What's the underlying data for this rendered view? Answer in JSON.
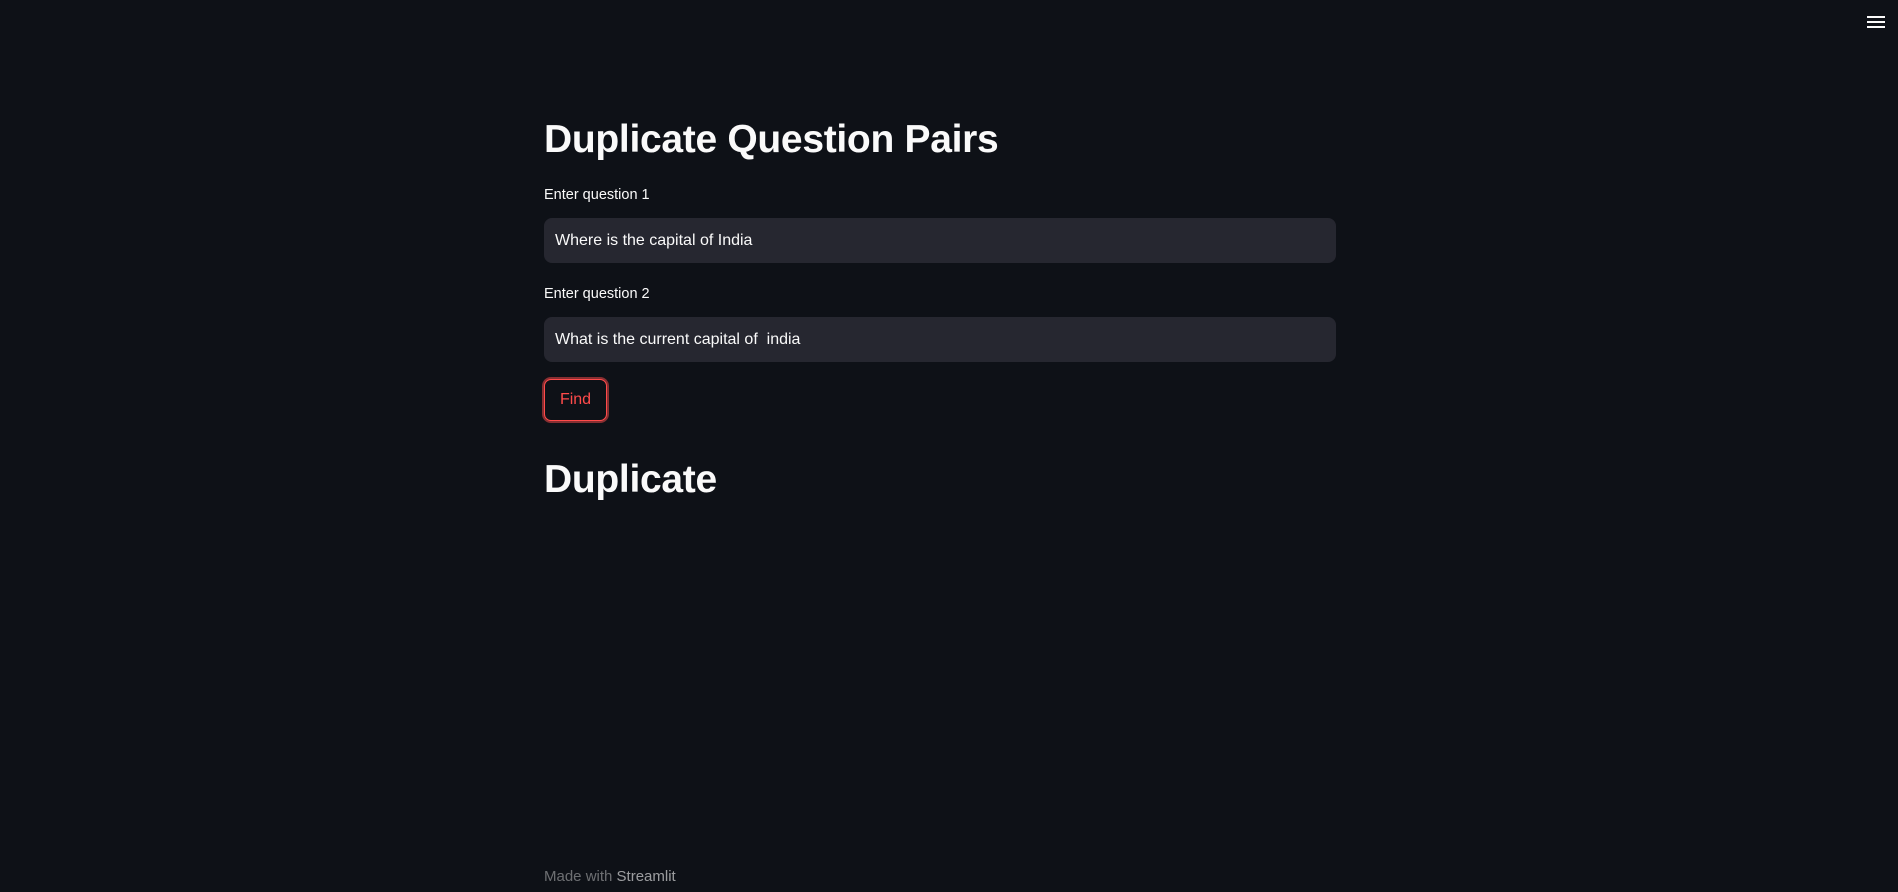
{
  "app": {
    "menu_icon": "hamburger-menu-icon"
  },
  "main": {
    "title": "Duplicate Question Pairs",
    "question1": {
      "label": "Enter question 1",
      "value": "Where is the capital of India"
    },
    "question2": {
      "label": "Enter question 2",
      "value": "What is the current capital of  india"
    },
    "find_button_label": "Find",
    "result": "Duplicate"
  },
  "footer": {
    "prefix": "Made with ",
    "link_label": "Streamlit"
  },
  "colors": {
    "background": "#0e1117",
    "input_background": "#262730",
    "accent": "#ff4b4b",
    "text": "#fafafa"
  }
}
